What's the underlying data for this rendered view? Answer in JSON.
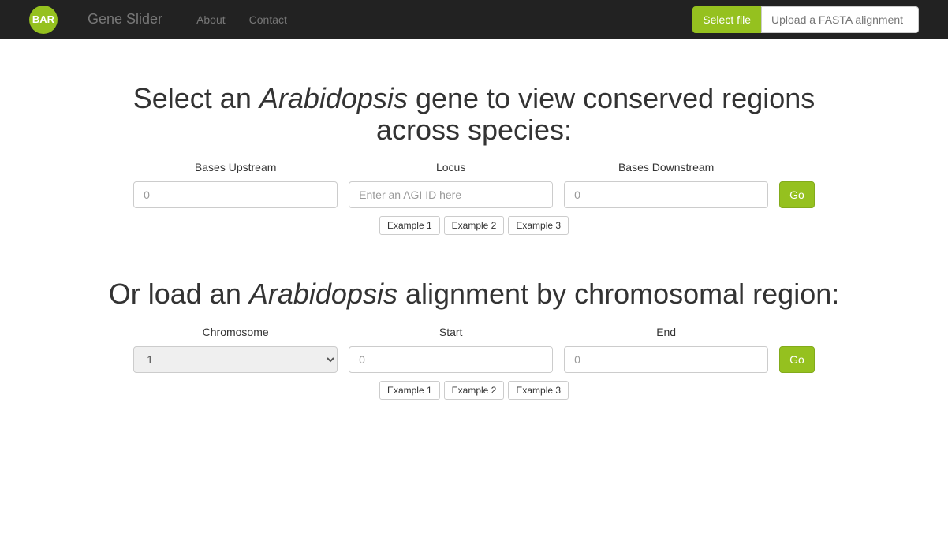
{
  "navbar": {
    "logo_text": "BAR",
    "title": "Gene Slider",
    "links": {
      "about": "About",
      "contact": "Contact"
    },
    "select_file_label": "Select file",
    "upload_placeholder": "Upload a FASTA alignment"
  },
  "section1": {
    "heading_pre": "Select an ",
    "heading_em": "Arabidopsis",
    "heading_post": " gene to view conserved regions across species:",
    "labels": {
      "upstream": "Bases Upstream",
      "locus": "Locus",
      "downstream": "Bases Downstream"
    },
    "placeholders": {
      "upstream": "0",
      "locus": "Enter an AGI ID here",
      "downstream": "0"
    },
    "go_label": "Go",
    "examples": {
      "ex1": "Example 1",
      "ex2": "Example 2",
      "ex3": "Example 3"
    }
  },
  "section2": {
    "heading_pre": "Or load an ",
    "heading_em": "Arabidopsis",
    "heading_post": " alignment by chromosomal region:",
    "labels": {
      "chromosome": "Chromosome",
      "start": "Start",
      "end": "End"
    },
    "chromosome_selected": "1",
    "placeholders": {
      "start": "0",
      "end": "0"
    },
    "go_label": "Go",
    "examples": {
      "ex1": "Example 1",
      "ex2": "Example 2",
      "ex3": "Example 3"
    }
  }
}
